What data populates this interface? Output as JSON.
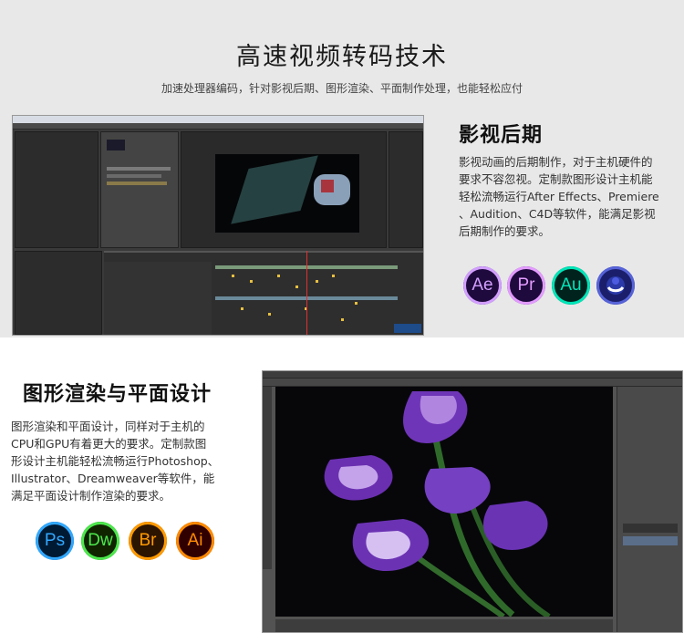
{
  "header": {
    "title": "高速视频转码技术",
    "subtitle": "加速处理器编码，针对影视后期、图形渲染、平面制作处理，也能轻松应付"
  },
  "film_section": {
    "heading": "影视后期",
    "body_lines": [
      "影视动画的后期制作，对于主机硬件的",
      "要求不容忽视。定制款图形设计主机能",
      "轻松流畅运行After Effects、Premiere",
      "、Audition、C4D等软件，能满足影视",
      "后期制作的要求。"
    ],
    "apps": [
      {
        "icon": "after-effects-icon",
        "label": "Ae",
        "bg": "#1f0a3d",
        "ring": "#d29eff",
        "fg": "#d29eff"
      },
      {
        "icon": "premiere-icon",
        "label": "Pr",
        "bg": "#1f0a3d",
        "ring": "#e39bff",
        "fg": "#e39bff"
      },
      {
        "icon": "audition-icon",
        "label": "Au",
        "bg": "#00231e",
        "ring": "#00e5b8",
        "fg": "#00e5b8"
      },
      {
        "icon": "cinema4d-icon",
        "label": "",
        "bg": "#1b1f6b",
        "ring": "#5663d8",
        "fg": "#ffffff"
      }
    ]
  },
  "graphics_section": {
    "heading": "图形渲染与平面设计",
    "body_lines": [
      "图形渲染和平面设计，同样对于主机的",
      "CPU和GPU有着更大的要求。定制款图",
      "形设计主机能轻松流畅运行Photoshop、",
      "Illustrator、Dreamweaver等软件，能",
      "满足平面设计制作渲染的要求。"
    ],
    "apps": [
      {
        "icon": "photoshop-icon",
        "label": "Ps",
        "bg": "#001a33",
        "ring": "#31a8ff",
        "fg": "#31a8ff"
      },
      {
        "icon": "dreamweaver-icon",
        "label": "Dw",
        "bg": "#102400",
        "ring": "#4ce84c",
        "fg": "#4ce84c"
      },
      {
        "icon": "bridge-icon",
        "label": "Br",
        "bg": "#2b1400",
        "ring": "#ff9a00",
        "fg": "#ff9a00"
      },
      {
        "icon": "illustrator-icon",
        "label": "Ai",
        "bg": "#300000",
        "ring": "#ff8a00",
        "fg": "#ff8a00"
      }
    ]
  },
  "screenshots": {
    "after_effects": "after-effects-screenshot",
    "photoshop": "photoshop-screenshot"
  }
}
